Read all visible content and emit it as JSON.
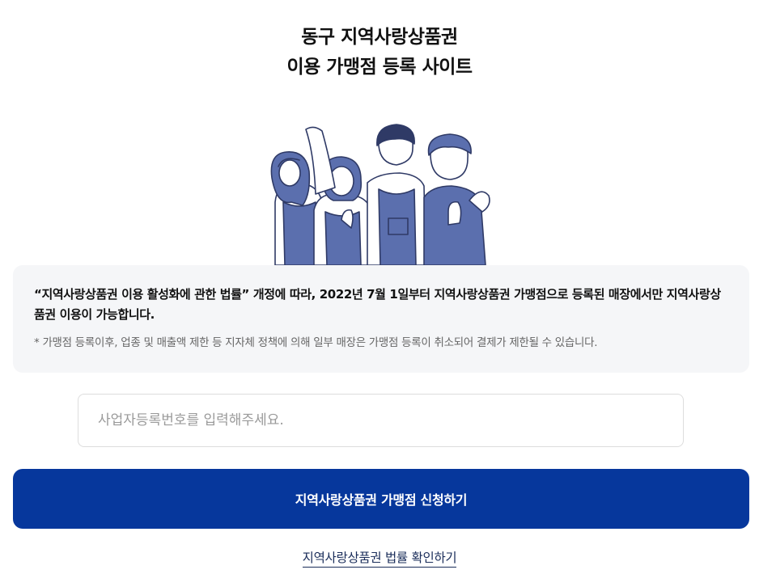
{
  "header": {
    "title_line1": "동구 지역사랑상품권",
    "title_line2": "이용 가맹점 등록 사이트"
  },
  "illustration": {
    "icon": "four-people-illustration",
    "colors": {
      "primary": "#5b6fae",
      "outline": "#2f3a66",
      "skin": "#ffffff"
    }
  },
  "notice": {
    "main": "“지역사랑상품권 이용 활성화에 관한 법률” 개정에 따라, 2022년 7월 1일부터 지역사랑상품권 가맹점으로 등록된 매장에서만 지역사랑상품권 이용이 가능합니다.",
    "sub": "* 가맹점 등록이후, 업종 및 매출액 제한 등 지자체 정책에 의해 일부 매장은 가맹점 등록이 취소되어 결제가 제한될 수 있습니다."
  },
  "form": {
    "business_number": {
      "value": "",
      "placeholder": "사업자등록번호를 입력해주세요."
    },
    "apply_label": "지역사랑상품권 가맹점 신청하기"
  },
  "footer": {
    "law_link_label": "지역사랑상품권 법률 확인하기"
  },
  "colors": {
    "accent": "#06379c",
    "notice_bg": "#f5f6f8",
    "muted_text": "#666666"
  }
}
